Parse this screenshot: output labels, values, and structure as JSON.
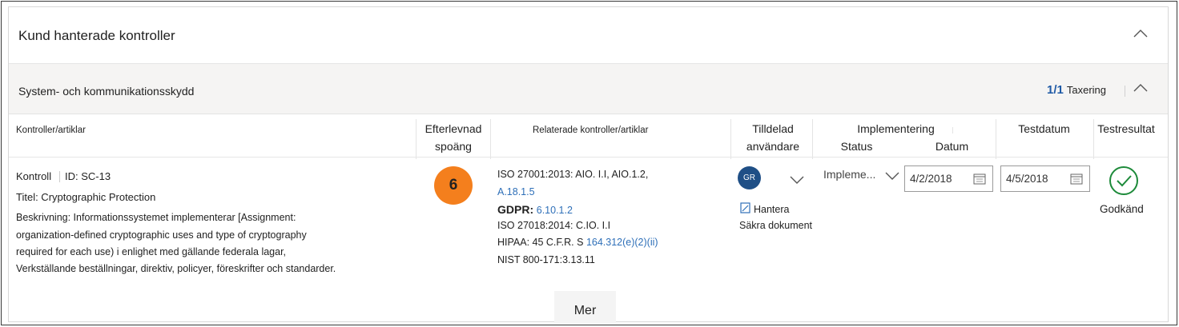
{
  "panel": {
    "title": "Kund hanterade kontroller"
  },
  "section": {
    "title": "System- och kommunikationsskydd",
    "score": "1/1",
    "score_label": "Taxering"
  },
  "columns": {
    "controls": "Kontroller/artiklar",
    "compliance_line1": "Efterlevnad",
    "compliance_line2": "spoäng",
    "related": "Relaterade kontroller/artiklar",
    "assigned_line1": "Tilldelad",
    "assigned_line2": "användare",
    "implementation": "Implementering",
    "status": "Status",
    "date": "Datum",
    "testdate": "Testdatum",
    "testresult": "Testresultat"
  },
  "row": {
    "control_label": "Kontroll",
    "id": "ID: SC-13",
    "title": "Titel: Cryptographic Protection",
    "description_lines": [
      "Beskrivning: Informationssystemet implementerar [Assignment:",
      "organization-defined cryptographic uses and type of cryptography",
      "required for each use) i enlighet med gällande federala lagar,",
      "Verkställande beställningar, direktiv, policyer, föreskrifter och standarder."
    ],
    "compliance_score": "6",
    "related": {
      "iso27001_prefix": "ISO 27001:2013: AIO. I.I, AIO.1.2,",
      "iso27001_link": "A.18.1.5",
      "gdpr_label": "GDPR:",
      "gdpr_link": "6.10.1.2",
      "iso27018": "ISO 27018:2014: C.IO. I.I",
      "hipaa_prefix": "HIPAA: 45 C.F.R. S",
      "hipaa_link": "164.312(e)(2)(ii)",
      "nist": "NIST 800-171:3.13.11"
    },
    "assignee_initials": "GR",
    "manage_label": "Hantera",
    "secure_docs": "Säkra dokument",
    "impl_status": "Impleme...",
    "impl_date": "4/2/2018",
    "test_date": "4/5/2018",
    "test_result": "Godkänd"
  },
  "more_button": "Mer",
  "colors": {
    "score_circle": "#f47f1d",
    "avatar": "#1f4f86",
    "link": "#2e6fb8",
    "pass": "#1d8a3a",
    "section_bg": "#f5f4f3"
  }
}
